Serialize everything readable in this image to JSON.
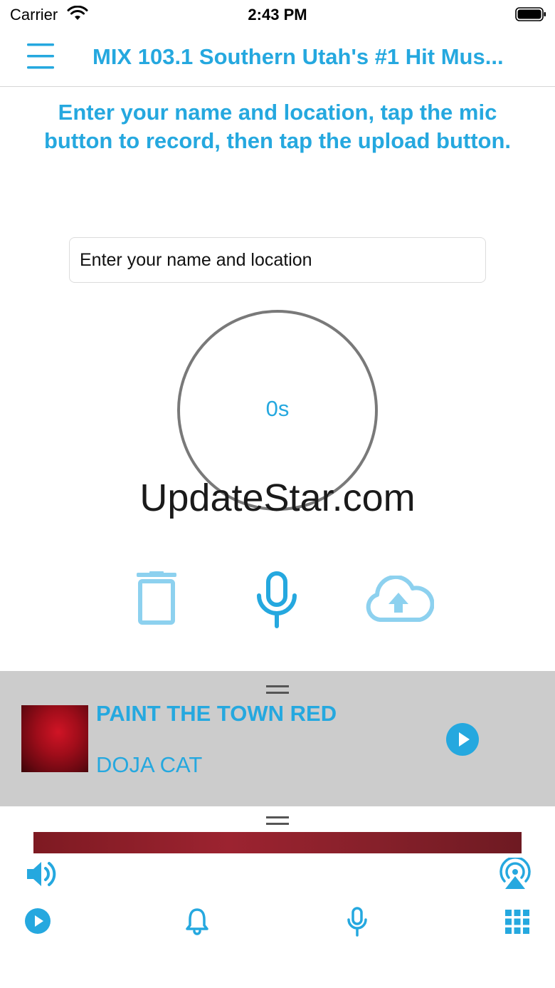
{
  "status_bar": {
    "carrier": "Carrier",
    "time": "2:43 PM",
    "icons": [
      "wifi-icon",
      "battery-icon"
    ]
  },
  "nav": {
    "menu_icon": "hamburger-menu-icon",
    "title": "MIX 103.1   Southern Utah's #1 Hit Mus..."
  },
  "instructions": "Enter your name and location, tap the mic button to record, then tap the upload button.",
  "form": {
    "name_placeholder": "Enter your name and location"
  },
  "recorder": {
    "timer": "0s",
    "buttons": [
      "trash-icon",
      "microphone-icon",
      "cloud-upload-icon"
    ]
  },
  "watermark": "UpdateStar.com",
  "now_playing": {
    "song": "PAINT THE TOWN RED",
    "artist": "DOJA CAT",
    "play_icon": "play-circle-icon"
  },
  "toolbar": {
    "icons": [
      "volume-icon",
      "airplay-icon",
      "play-circle-icon",
      "bell-icon",
      "microphone-icon",
      "grid-icon"
    ]
  },
  "colors": {
    "accent": "#25a8df",
    "accent_light": "#8dd1ef",
    "now_playing_bg": "#cccccc",
    "ring": "#797979"
  }
}
